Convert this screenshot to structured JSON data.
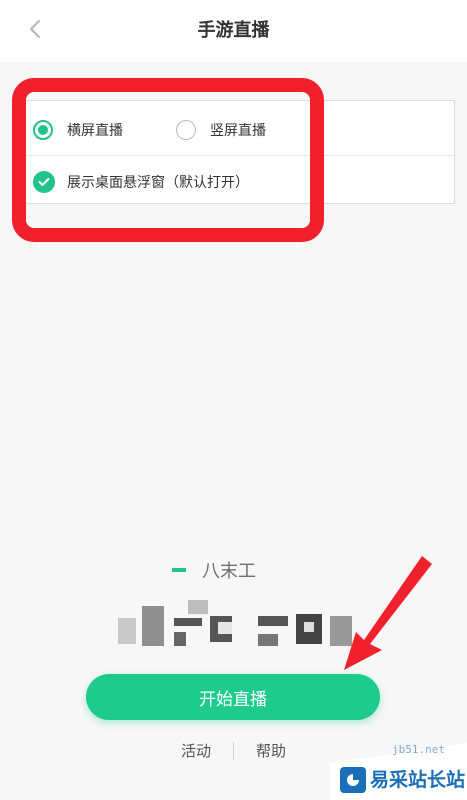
{
  "header": {
    "title": "手游直播",
    "back_icon": "chevron-left-icon"
  },
  "options": {
    "landscape_label": "横屏直播",
    "portrait_label": "竖屏直播",
    "landscape_selected": true,
    "floating_window_label": "展示桌面悬浮窗（默认打开）",
    "floating_window_checked": true
  },
  "quality": {
    "label": "八末工"
  },
  "actions": {
    "start_label": "开始直播"
  },
  "links": {
    "activity_label": "活动",
    "help_label": "帮助"
  },
  "watermark": {
    "brand_text": "易采站长站",
    "url_text": "jb51.net"
  },
  "colors": {
    "accent": "#21c28c",
    "highlight": "#f1202d",
    "brand": "#1a6fb8"
  }
}
